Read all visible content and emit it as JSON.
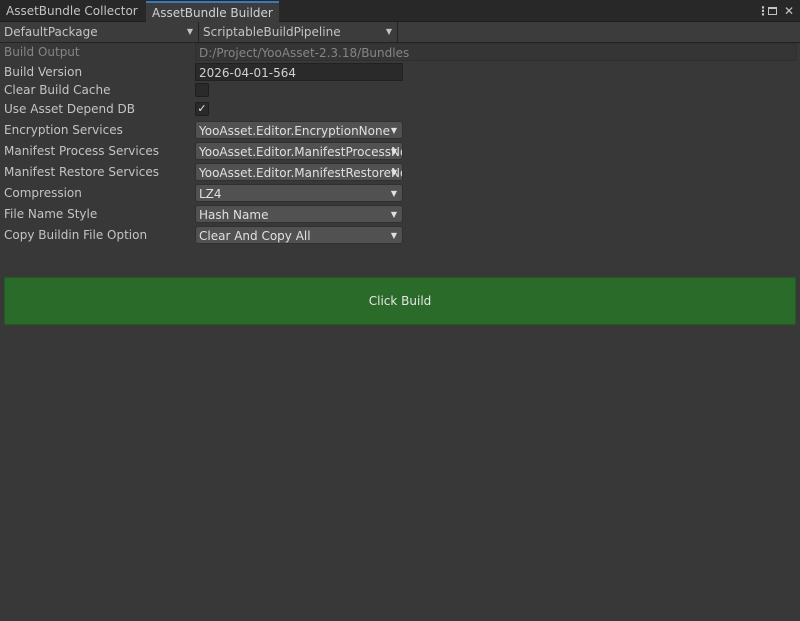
{
  "tabs": {
    "collector": "AssetBundle Collector",
    "builder": "AssetBundle Builder"
  },
  "window_icons": [
    "kebab-menu-icon",
    "maximize-icon",
    "close-icon"
  ],
  "toolbar": {
    "package": "DefaultPackage",
    "pipeline": "ScriptableBuildPipeline"
  },
  "form": {
    "build_output": {
      "label": "Build Output",
      "value": "D:/Project/YooAsset-2.3.18/Bundles"
    },
    "build_version": {
      "label": "Build Version",
      "value": "2026-04-01-564"
    },
    "clear_build_cache": {
      "label": "Clear Build Cache",
      "checked": false
    },
    "use_asset_depend_db": {
      "label": "Use Asset Depend DB",
      "checked": true,
      "mark": "✓"
    },
    "encryption_services": {
      "label": "Encryption Services",
      "value": "YooAsset.Editor.EncryptionNone"
    },
    "manifest_process_services": {
      "label": "Manifest Process Services",
      "value": "YooAsset.Editor.ManifestProcessNone"
    },
    "manifest_restore_services": {
      "label": "Manifest Restore Services",
      "value": "YooAsset.Editor.ManifestRestoreNone"
    },
    "compression": {
      "label": "Compression",
      "value": "LZ4"
    },
    "file_name_style": {
      "label": "File Name Style",
      "value": "Hash Name"
    },
    "copy_buildin_file_option": {
      "label": "Copy Buildin File Option",
      "value": "Clear And Copy All"
    }
  },
  "build_button": {
    "label": "Click Build"
  },
  "colors": {
    "background": "#383838",
    "tab_accent": "#3a79bb",
    "build_button": "#2a6b2a"
  }
}
